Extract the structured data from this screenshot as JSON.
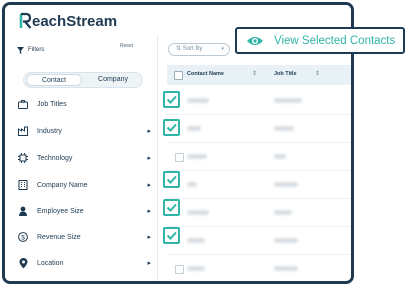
{
  "app": {
    "logo_text": "eachStream"
  },
  "filters": {
    "title": "Filters",
    "reset_label": "Reset"
  },
  "toggle": {
    "contact_label": "Contact",
    "company_label": "Company"
  },
  "filter_items": [
    {
      "label": "Job Titles"
    },
    {
      "label": "Industry"
    },
    {
      "label": "Technology"
    },
    {
      "label": "Company Name"
    },
    {
      "label": "Employee Size"
    },
    {
      "label": "Revenue Size"
    },
    {
      "label": "Location"
    }
  ],
  "sort": {
    "label": "Sort By"
  },
  "table": {
    "columns": [
      "Contact Name",
      "Job Title"
    ],
    "sort_icon": "⇕",
    "rows": [
      {
        "selected": true
      },
      {
        "selected": true
      },
      {
        "selected": false
      },
      {
        "selected": true
      },
      {
        "selected": true
      },
      {
        "selected": true
      },
      {
        "selected": false
      }
    ]
  },
  "callout": {
    "label": "View Selected Contacts"
  },
  "colors": {
    "accent": "#2fb4a6",
    "navy": "#1d3a52"
  }
}
